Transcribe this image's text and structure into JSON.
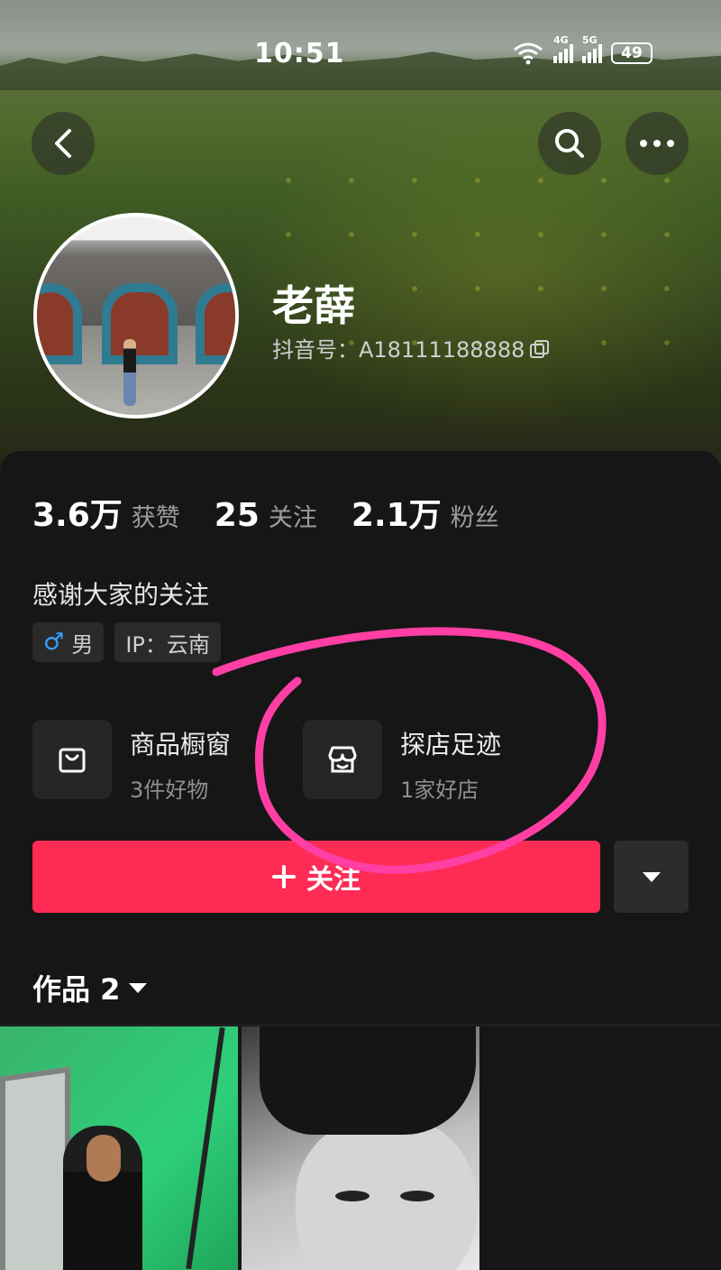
{
  "status_bar": {
    "time": "10:51",
    "net1": "4G",
    "net2": "5G",
    "battery": "49"
  },
  "header": {
    "back_icon": "back-arrow-icon",
    "search_icon": "search-icon",
    "more_icon": "more-dots-icon"
  },
  "profile": {
    "nickname": "老薛",
    "douyin_id": "抖音号：A18111188888"
  },
  "stats": [
    {
      "value": "3.6万",
      "label": "获赞"
    },
    {
      "value": "25",
      "label": "关注"
    },
    {
      "value": "2.1万",
      "label": "粉丝"
    }
  ],
  "bio": "感谢大家的关注",
  "tags": {
    "gender": "男",
    "ip": "IP：云南"
  },
  "features": [
    {
      "title": "商品橱窗",
      "subtitle": "3件好物",
      "icon": "shopping-bag-icon"
    },
    {
      "title": "探店足迹",
      "subtitle": "1家好店",
      "icon": "store-icon"
    }
  ],
  "actions": {
    "follow_label": "关注"
  },
  "works": {
    "label": "作品 2"
  },
  "colors": {
    "follow_button": "#fe2c55",
    "annotation": "#ff3fa4",
    "background": "#161616"
  }
}
